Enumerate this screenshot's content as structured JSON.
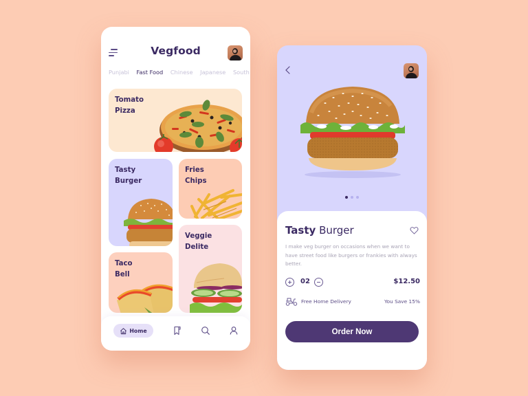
{
  "colors": {
    "background": "#fdccb4",
    "primary": "#4e3874",
    "text_dark": "#3b2a63",
    "text_muted": "#a8a3b5",
    "lavender": "#d8d6fd",
    "peach": "#fdccb4",
    "cream": "#fde8d1",
    "pink": "#fbe1e3"
  },
  "home_screen": {
    "title": "Vegfood",
    "menu_icon": "hamburger-menu-icon",
    "avatar_icon": "user-avatar",
    "categories": [
      {
        "label": "Punjabi",
        "active": false
      },
      {
        "label": "Fast Food",
        "active": true
      },
      {
        "label": "Chinese",
        "active": false
      },
      {
        "label": "Japanese",
        "active": false
      },
      {
        "label": "South",
        "active": false
      }
    ],
    "cards": [
      {
        "line1": "Tomato",
        "line2": "Pizza",
        "image": "pizza-image"
      },
      {
        "line1": "Tasty",
        "line2": "Burger",
        "image": "burger-image"
      },
      {
        "line1": "Fries",
        "line2": "Chips",
        "image": "fries-image"
      },
      {
        "line1": "Taco",
        "line2": "Bell",
        "image": "taco-image"
      },
      {
        "line1": "Veggie",
        "line2": "Delite",
        "image": "sandwich-image"
      }
    ],
    "bottom_nav": {
      "home_label": "Home",
      "items": [
        "home-icon",
        "bookmark-icon",
        "search-icon",
        "user-icon"
      ]
    }
  },
  "detail_screen": {
    "back_icon": "chevron-left-icon",
    "avatar_icon": "user-avatar",
    "carousel": {
      "count": 3,
      "active_index": 0
    },
    "title_bold": "Tasty",
    "title_regular": "Burger",
    "favorite_icon": "heart-icon",
    "description": "I make veg burger on occasions when we want to have street food like burgers or frankies with always better.",
    "quantity": "02",
    "price": "$12.50",
    "delivery_icon": "scooter-icon",
    "delivery_text": "Free Home Delivery",
    "savings_text": "You Save 15%",
    "order_button": "Order Now"
  }
}
